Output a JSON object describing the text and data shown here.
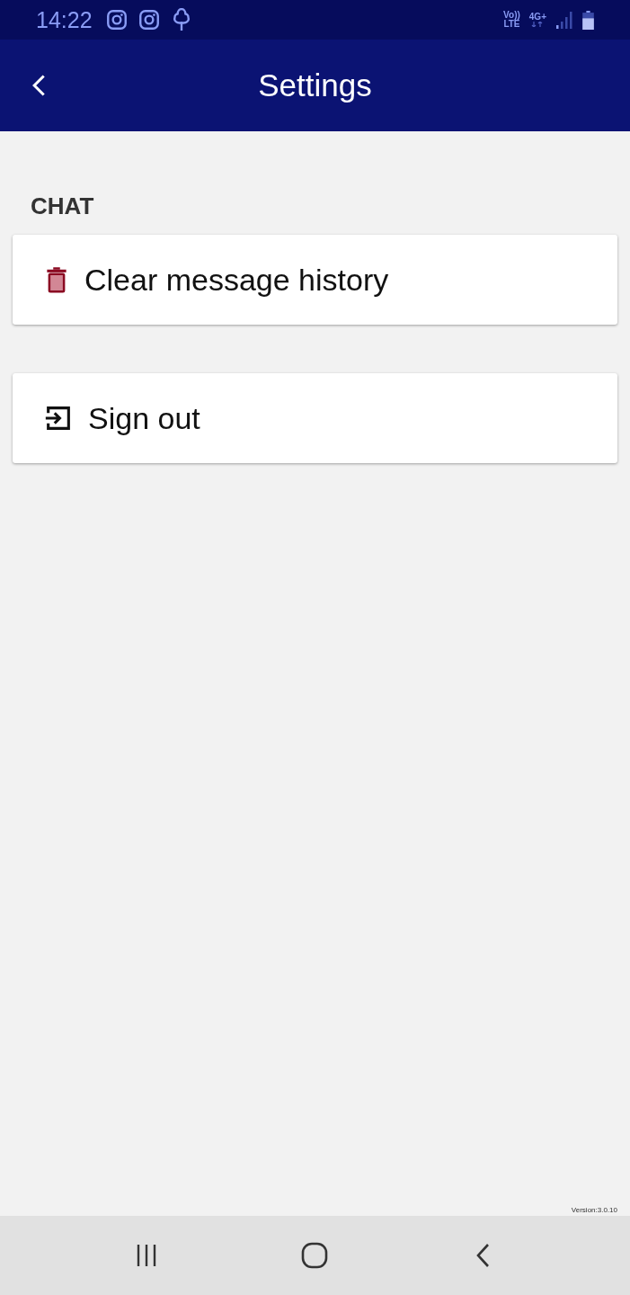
{
  "status_bar": {
    "time": "14:22",
    "volte_top": "Vo))",
    "volte_bottom": "LTE",
    "network": "4G+"
  },
  "app_bar": {
    "title": "Settings"
  },
  "sections": [
    {
      "header": "CHAT",
      "items": [
        {
          "kind": "delete",
          "label": "Clear message history"
        }
      ]
    },
    {
      "items": [
        {
          "kind": "signout",
          "label": "Sign out"
        }
      ]
    }
  ],
  "version": "Version:3.0.10"
}
